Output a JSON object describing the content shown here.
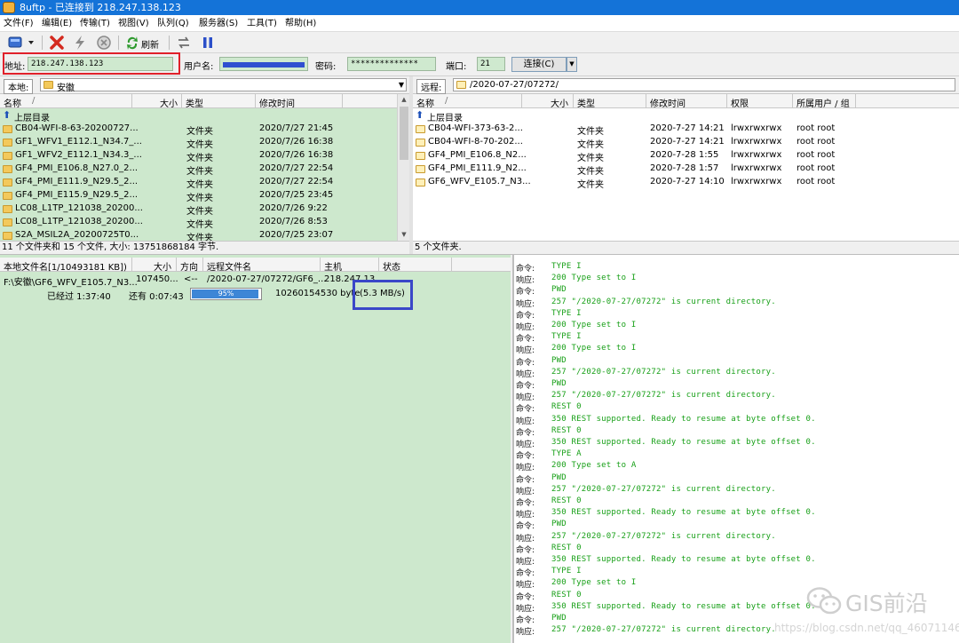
{
  "window": {
    "title": "8uftp - 已连接到 218.247.138.123"
  },
  "menu": [
    "文件(F)",
    "编辑(E)",
    "传输(T)",
    "视图(V)",
    "队列(Q)",
    "服务器(S)",
    "工具(T)",
    "帮助(H)"
  ],
  "toolbar": {
    "refresh_label": "刷新"
  },
  "connection": {
    "address_label": "地址:",
    "address_value": "218.247.138.123",
    "user_label": "用户名:",
    "password_label": "密码:",
    "password_value": "**************",
    "port_label": "端口:",
    "port_value": "21",
    "connect_label": "连接(C)"
  },
  "local": {
    "path_label": "本地:",
    "path_value": "安徽",
    "columns": [
      "名称",
      "大小",
      "类型",
      "修改时间"
    ],
    "sort_mark": "/",
    "parent": "上层目录",
    "rows": [
      {
        "name": "CB04-WFI-8-63-20200727...",
        "type": "文件夹",
        "time": "2020/7/27 21:45"
      },
      {
        "name": "GF1_WFV1_E112.1_N34.7_...",
        "type": "文件夹",
        "time": "2020/7/26 16:38"
      },
      {
        "name": "GF1_WFV2_E112.1_N34.3_...",
        "type": "文件夹",
        "time": "2020/7/26 16:38"
      },
      {
        "name": "GF4_PMI_E106.8_N27.0_2...",
        "type": "文件夹",
        "time": "2020/7/27 22:54"
      },
      {
        "name": "GF4_PMI_E111.9_N29.5_2...",
        "type": "文件夹",
        "time": "2020/7/27 22:54"
      },
      {
        "name": "GF4_PMI_E115.9_N29.5_2...",
        "type": "文件夹",
        "time": "2020/7/25 23:45"
      },
      {
        "name": "LC08_L1TP_121038_20200...",
        "type": "文件夹",
        "time": "2020/7/26 9:22"
      },
      {
        "name": "LC08_L1TP_121038_20200...",
        "type": "文件夹",
        "time": "2020/7/26 8:53"
      },
      {
        "name": "S2A_MSIL2A_20200725T0...",
        "type": "文件夹",
        "time": "2020/7/25 23:07"
      }
    ],
    "status": "11 个文件夹和 15 个文件, 大小: 13751868184 字节."
  },
  "remote": {
    "path_label": "远程:",
    "path_value": "/2020-07-27/07272/",
    "columns": [
      "名称",
      "大小",
      "类型",
      "修改时间",
      "权限",
      "所属用户 / 组"
    ],
    "sort_mark": "/",
    "parent": "上层目录",
    "rows": [
      {
        "name": "CB04-WFI-373-63-2...",
        "type": "文件夹",
        "time": "2020-7-27 14:21",
        "perm": "lrwxrwxrwx",
        "owner": "root root"
      },
      {
        "name": "CB04-WFI-8-70-202...",
        "type": "文件夹",
        "time": "2020-7-27 14:21",
        "perm": "lrwxrwxrwx",
        "owner": "root root"
      },
      {
        "name": "GF4_PMI_E106.8_N2...",
        "type": "文件夹",
        "time": "2020-7-28 1:55",
        "perm": "lrwxrwxrwx",
        "owner": "root root"
      },
      {
        "name": "GF4_PMI_E111.9_N2...",
        "type": "文件夹",
        "time": "2020-7-28 1:57",
        "perm": "lrwxrwxrwx",
        "owner": "root root"
      },
      {
        "name": "GF6_WFV_E105.7_N3...",
        "type": "文件夹",
        "time": "2020-7-27 14:10",
        "perm": "lrwxrwxrwx",
        "owner": "root root"
      }
    ],
    "status": "5 个文件夹."
  },
  "queue": {
    "columns": [
      "本地文件名[1/10493181 KB])",
      "大小",
      "方向",
      "远程文件名",
      "主机",
      "状态"
    ],
    "item": {
      "local": "F:\\安徽\\GF6_WFV_E105.7_N3...",
      "size": "107450...",
      "dir": "<--",
      "remote": "/2020-07-27/07272/GF6_...",
      "host": "218.247.13...",
      "elapsed": "已经过 1:37:40",
      "remaining": "还有 0:07:43",
      "progress_pct": 95,
      "progress_text": "95%",
      "bytes": "10260154530 byte",
      "speed": "(5.3 MB/s)"
    }
  },
  "log": [
    {
      "k": "命令:",
      "m": "TYPE I"
    },
    {
      "k": "响应:",
      "m": "200 Type set to I"
    },
    {
      "k": "命令:",
      "m": "PWD"
    },
    {
      "k": "响应:",
      "m": "257 \"/2020-07-27/07272\" is current directory."
    },
    {
      "k": "命令:",
      "m": "TYPE I"
    },
    {
      "k": "响应:",
      "m": "200 Type set to I"
    },
    {
      "k": "命令:",
      "m": "TYPE I"
    },
    {
      "k": "响应:",
      "m": "200 Type set to I"
    },
    {
      "k": "命令:",
      "m": "PWD"
    },
    {
      "k": "响应:",
      "m": "257 \"/2020-07-27/07272\" is current directory."
    },
    {
      "k": "命令:",
      "m": "PWD"
    },
    {
      "k": "响应:",
      "m": "257 \"/2020-07-27/07272\" is current directory."
    },
    {
      "k": "命令:",
      "m": "REST 0"
    },
    {
      "k": "响应:",
      "m": "350 REST supported. Ready to resume at byte offset 0."
    },
    {
      "k": "命令:",
      "m": "REST 0"
    },
    {
      "k": "响应:",
      "m": "350 REST supported. Ready to resume at byte offset 0."
    },
    {
      "k": "命令:",
      "m": "TYPE A"
    },
    {
      "k": "响应:",
      "m": "200 Type set to A"
    },
    {
      "k": "命令:",
      "m": "PWD"
    },
    {
      "k": "响应:",
      "m": "257 \"/2020-07-27/07272\" is current directory."
    },
    {
      "k": "命令:",
      "m": "REST 0"
    },
    {
      "k": "响应:",
      "m": "350 REST supported. Ready to resume at byte offset 0."
    },
    {
      "k": "命令:",
      "m": "PWD"
    },
    {
      "k": "响应:",
      "m": "257 \"/2020-07-27/07272\" is current directory."
    },
    {
      "k": "命令:",
      "m": "REST 0"
    },
    {
      "k": "响应:",
      "m": "350 REST supported. Ready to resume at byte offset 0."
    },
    {
      "k": "命令:",
      "m": "TYPE I"
    },
    {
      "k": "响应:",
      "m": "200 Type set to I"
    },
    {
      "k": "命令:",
      "m": "REST 0"
    },
    {
      "k": "响应:",
      "m": "350 REST supported. Ready to resume at byte offset 0."
    },
    {
      "k": "命令:",
      "m": "PWD"
    },
    {
      "k": "响应:",
      "m": "257 \"/2020-07-27/07272\" is current directory."
    }
  ],
  "watermark": {
    "brand": "GIS前沿",
    "url": "https://blog.csdn.net/qq_46071146"
  },
  "colors": {
    "title_bar": "#1473d8",
    "pane_green": "#cde8cd",
    "log_green": "#18a018",
    "highlight_red": "#e0202a",
    "highlight_blue": "#3a47c8",
    "progress": "#3d86d6"
  }
}
